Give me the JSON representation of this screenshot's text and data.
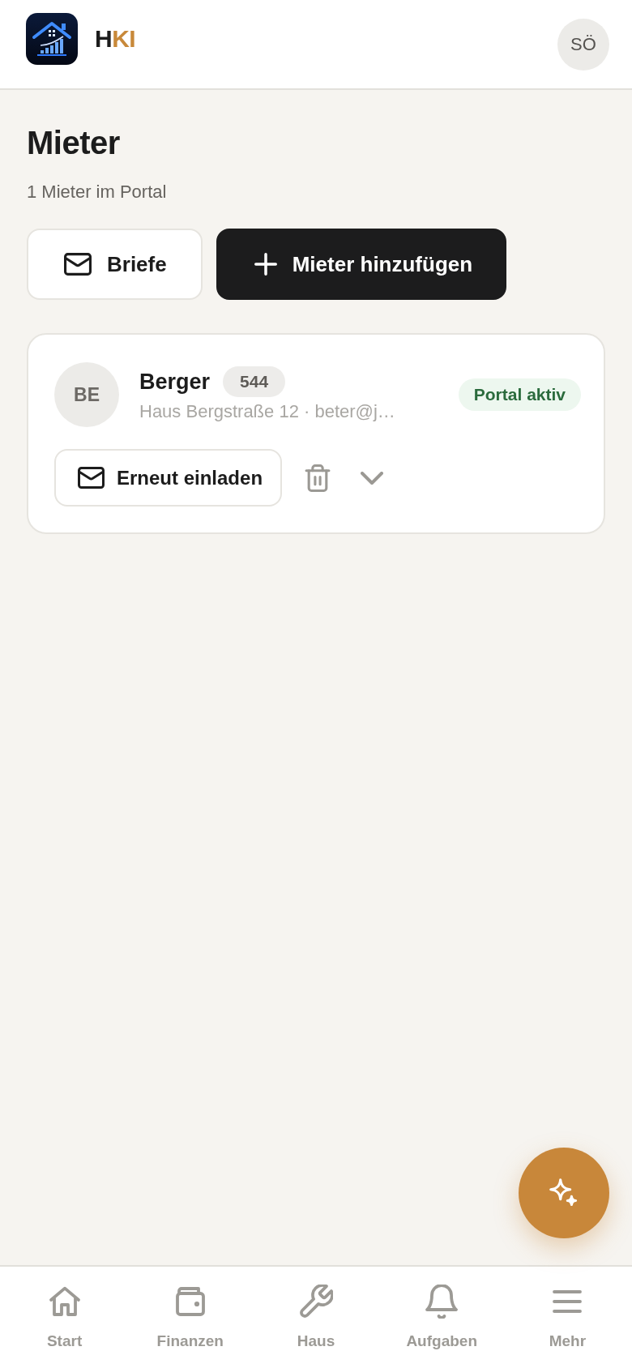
{
  "header": {
    "brand": {
      "first": "H",
      "accent": "KI"
    },
    "user_initials": "SÖ"
  },
  "page": {
    "title": "Mieter",
    "subtitle": "1 Mieter im Portal"
  },
  "actions": [
    {
      "kind": "secondary",
      "label": "Briefe"
    },
    {
      "kind": "primary",
      "label": "Mieter hinzufügen"
    }
  ],
  "tenants": [
    {
      "initials": "BE",
      "name": "Berger",
      "unit": "544",
      "details": "Haus Bergstraße 12 · beter@j…",
      "status": {
        "kind": "active",
        "label": "Portal aktiv"
      },
      "invite_label": "Erneut einladen",
      "expanded": false
    }
  ],
  "nav": [
    {
      "label": "Start",
      "selected": false
    },
    {
      "label": "Finanzen",
      "selected": false
    },
    {
      "label": "Haus",
      "selected": false
    },
    {
      "label": "Aufgaben",
      "selected": false
    },
    {
      "label": "Mehr",
      "selected": false
    }
  ]
}
